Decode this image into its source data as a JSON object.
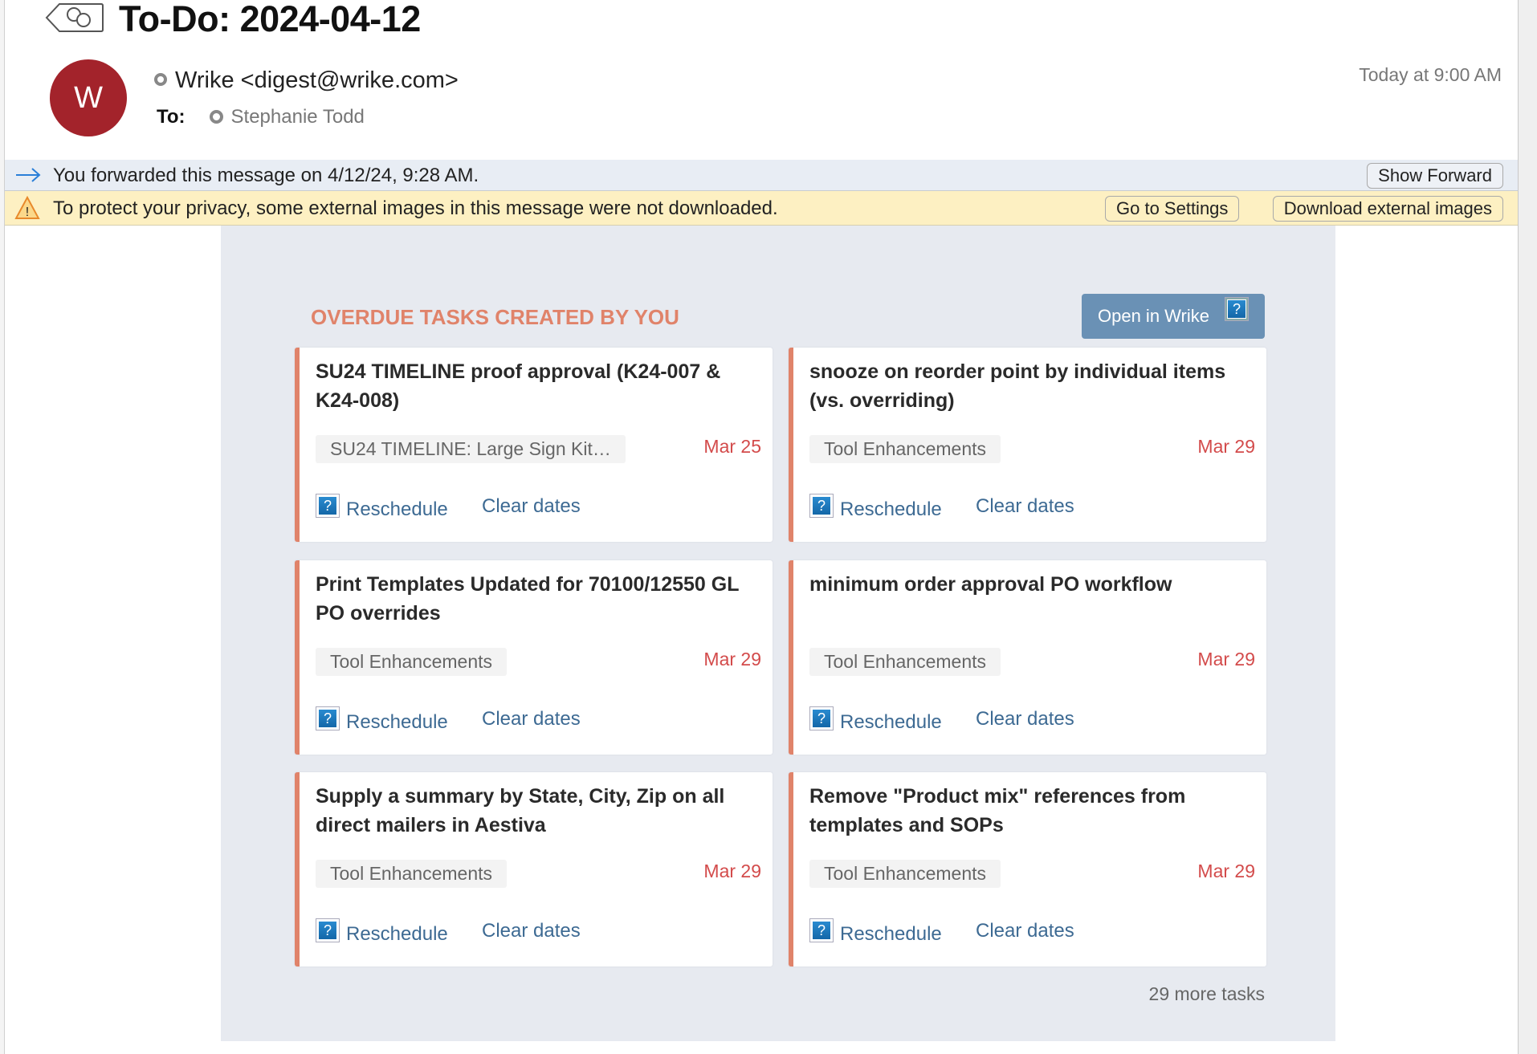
{
  "email": {
    "subject": "To-Do: 2024-04-12",
    "avatar_letter": "W",
    "sender": "Wrike <digest@wrike.com>",
    "to_label": "To:",
    "recipient": "Stephanie Todd",
    "timestamp": "Today at 9:00 AM"
  },
  "forward_bar": {
    "text": "You forwarded this message on 4/12/24, 9:28 AM.",
    "button": "Show Forward"
  },
  "privacy_bar": {
    "text": "To protect your privacy, some external images in this message were not downloaded.",
    "settings_button": "Go to Settings",
    "download_button": "Download external images"
  },
  "digest": {
    "heading": "OVERDUE TASKS CREATED BY YOU",
    "open_button": "Open in Wrike",
    "reschedule_label": "Reschedule",
    "clear_label": "Clear dates",
    "more_tasks": "29 more tasks",
    "tasks": [
      {
        "title": "SU24 TIMELINE proof approval (K24-007 & K24-008)",
        "tag": "SU24 TIMELINE: Large Sign Kit…",
        "date": "Mar 25"
      },
      {
        "title": "snooze on reorder point by individual items (vs. overriding)",
        "tag": "Tool Enhancements",
        "date": "Mar 29"
      },
      {
        "title": "Print Templates Updated for 70100/12550 GL PO overrides",
        "tag": "Tool Enhancements",
        "date": "Mar 29"
      },
      {
        "title": "minimum order approval PO workflow",
        "tag": "Tool Enhancements",
        "date": "Mar 29"
      },
      {
        "title": "Supply a summary by State, City, Zip on all direct mailers in Aestiva",
        "tag": "Tool Enhancements",
        "date": "Mar 29"
      },
      {
        "title": "Remove \"Product mix\" references from templates and SOPs",
        "tag": "Tool Enhancements",
        "date": "Mar 29"
      }
    ]
  },
  "colors": {
    "accent": "#e0836a",
    "date": "#d34b4b",
    "link": "#3d6a93",
    "avatar": "#a3232b",
    "button": "#6a91b5"
  }
}
